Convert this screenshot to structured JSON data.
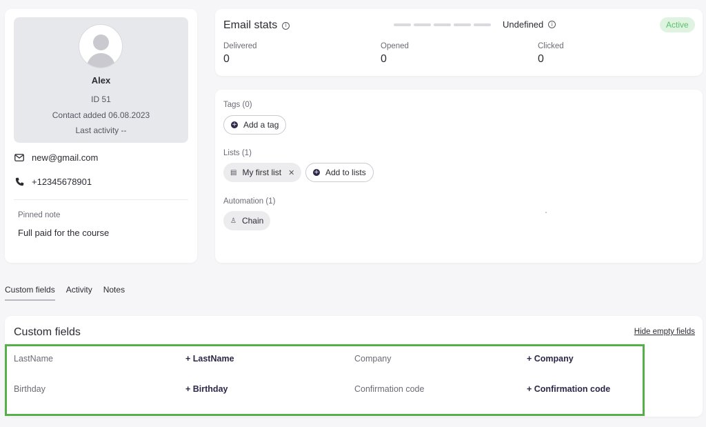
{
  "profile": {
    "name": "Alex",
    "id": "ID 51",
    "added": "Contact added 06.08.2023",
    "last_activity": "Last activity --",
    "email": "new@gmail.com",
    "phone": "+12345678901",
    "pinned_note_label": "Pinned note",
    "pinned_note": "Full paid for the course"
  },
  "email_stats": {
    "title": "Email stats",
    "status": "Undefined",
    "badge": "Active",
    "delivered_label": "Delivered",
    "delivered_value": "0",
    "opened_label": "Opened",
    "opened_value": "0",
    "clicked_label": "Clicked",
    "clicked_value": "0"
  },
  "segments": {
    "tags_label": "Tags (0)",
    "add_tag": "Add a tag",
    "lists_label": "Lists (1)",
    "list_chip": "My first list",
    "add_lists": "Add to lists",
    "automation_label": "Automation (1)",
    "automation_chip": "Chain"
  },
  "tabs": [
    "Custom fields",
    "Activity",
    "Notes"
  ],
  "custom_fields": {
    "title": "Custom fields",
    "hide_empty": "Hide empty fields",
    "rows": [
      [
        "LastName",
        "+ LastName",
        "Company",
        "+ Company"
      ],
      [
        "Birthday",
        "+ Birthday",
        "Confirmation code",
        "+ Confirmation code"
      ]
    ]
  },
  "colors": {
    "accent": "#2d2748",
    "active_badge_bg": "#dff3e1",
    "active_badge_text": "#5bbf6a",
    "highlight_border": "#55b04a"
  }
}
